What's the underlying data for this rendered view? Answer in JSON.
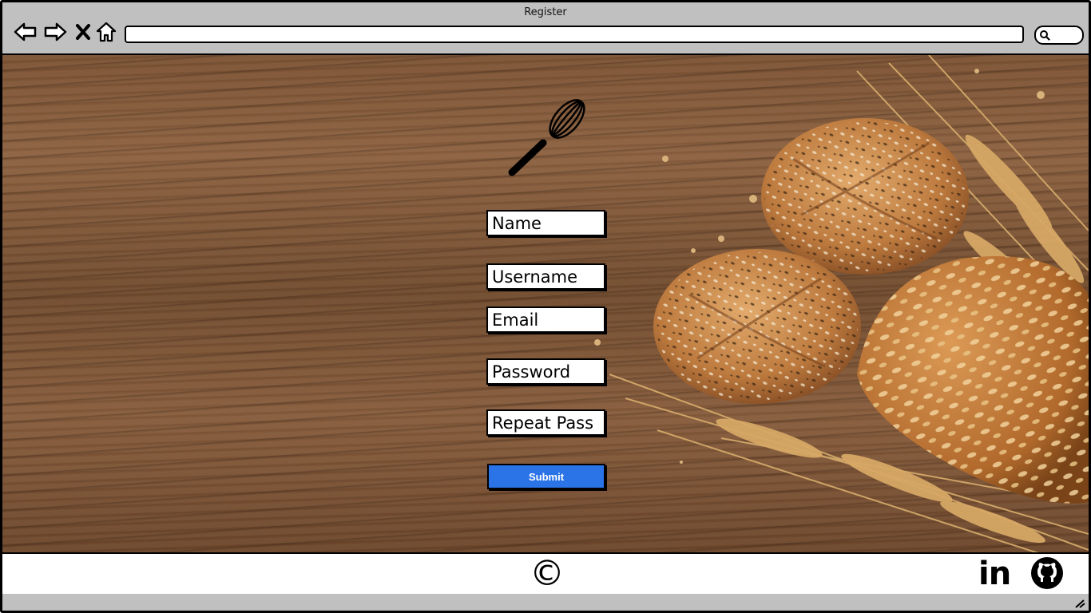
{
  "window": {
    "title": "Register"
  },
  "toolbar": {
    "icons": [
      "back-arrow-icon",
      "forward-arrow-icon",
      "stop-icon",
      "home-icon",
      "search-icon"
    ],
    "address_value": "",
    "search_value": ""
  },
  "form": {
    "name_placeholder": "Name",
    "username_placeholder": "Username",
    "email_placeholder": "Email",
    "password_placeholder": "Password",
    "repeat_password_placeholder": "Repeat Pass",
    "submit_label": "Submit",
    "submit_color": "#2a74e8"
  },
  "logo": {
    "icon": "whisk-icon"
  },
  "footer": {
    "copyright_symbol": "©",
    "linkedin_label": "in",
    "github_icon": "github-icon"
  }
}
